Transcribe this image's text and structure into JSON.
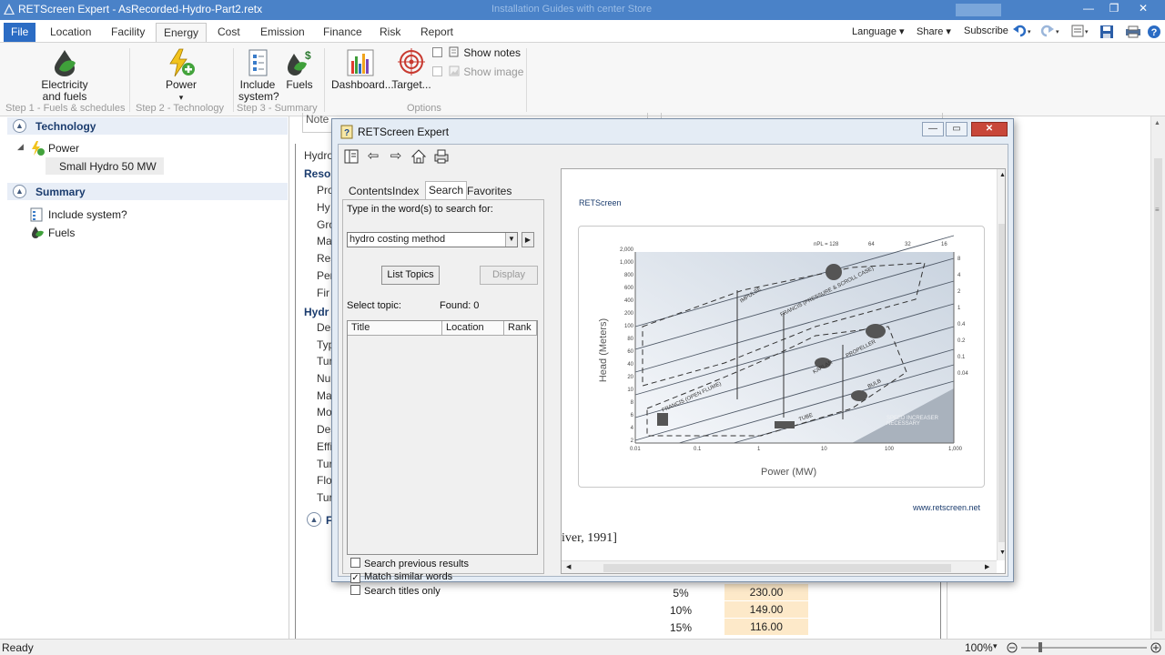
{
  "window": {
    "title": "RETScreen Expert - AsRecorded-Hydro-Part2.retx",
    "background_title": "Installation Guides with center Store"
  },
  "ribbon_tabs": [
    "File",
    "Location",
    "Facility",
    "Energy",
    "Cost",
    "Emission",
    "Finance",
    "Risk",
    "Report"
  ],
  "active_tab": "Energy",
  "right_menu": {
    "language": "Language ▾",
    "share": "Share ▾",
    "subscribe": "Subscribe"
  },
  "ribbon": {
    "electricity": "Electricity\nand fuels",
    "electricity_l1": "Electricity",
    "electricity_l2": "and fuels",
    "power": "Power",
    "power_arrow": "▾",
    "include_l1": "Include",
    "include_l2": "system?",
    "fuels": "Fuels",
    "dashboard": "Dashboard...",
    "target": "Target...",
    "show_notes": "Show notes",
    "show_image": "Show image",
    "group_step1": "Step 1 - Fuels & schedules",
    "group_step2": "Step 2 - Technology",
    "group_step3": "Step 3 - Summary",
    "group_options": "Options",
    "icons": {
      "electricity": "drop-leaf-icon",
      "power": "bolt-plus-icon",
      "include": "checklist-icon",
      "fuels": "fuels-icon",
      "dashboard": "bar-chart-icon",
      "target": "target-icon"
    }
  },
  "left_tree": {
    "technology_header": "Technology",
    "power": "Power",
    "power_child": "Small Hydro 50 MW",
    "summary_header": "Summary",
    "include_system": "Include system?",
    "fuels": "Fuels"
  },
  "background": {
    "note": "Note",
    "hydro": "Hydro",
    "resource": "Resou",
    "labels_a": [
      "Pro",
      "Hy",
      "Gro",
      "Ma",
      "Res",
      "Per",
      "Fir"
    ],
    "hydro_bold": "Hydr",
    "labels_b": [
      "Des",
      "Typ",
      "Tur",
      "Nu",
      "Ma",
      "Mo",
      "Des",
      "Effi",
      "Tur",
      "Flo",
      "Tur"
    ],
    "f_section": "F",
    "rows": [
      {
        "pct": "5%",
        "value": "230.00"
      },
      {
        "pct": "10%",
        "value": "149.00"
      },
      {
        "pct": "15%",
        "value": "116.00"
      }
    ]
  },
  "help": {
    "title": "RETScreen Expert",
    "tabs": [
      "Contents",
      "Index",
      "Search",
      "Favorites"
    ],
    "active_tab": "Search",
    "prompt": "Type in the word(s) to search for:",
    "search_value": "hydro costing method",
    "list_topics": "List Topics",
    "display": "Display",
    "select_topic": "Select topic:",
    "found": "Found: 0",
    "columns": [
      "Title",
      "Location",
      "Rank"
    ],
    "options": [
      {
        "label": "Search previous results",
        "checked": false
      },
      {
        "label": "Match similar words",
        "checked": true
      },
      {
        "label": "Search titles only",
        "checked": false
      }
    ],
    "content": {
      "brand": "RETScreen",
      "website": "www.retscreen.net",
      "citation": "iver, 1991]",
      "figure_ylabel": "Head (Meters)",
      "figure_xlabel": "Power (MW)",
      "y_ticks": [
        "2,000",
        "1,000",
        "800",
        "600",
        "400",
        "200",
        "100",
        "80",
        "60",
        "40",
        "20",
        "10",
        "8",
        "6",
        "4",
        "2"
      ],
      "x_ticks": [
        "0.01",
        "0.1",
        "1",
        "10",
        "100",
        "1,000"
      ],
      "right_ticks": [
        "8",
        "4",
        "2",
        "1",
        "0.4",
        "0.2",
        "0.1",
        "0.04"
      ],
      "top_ticks": [
        "nPL = 128",
        "64",
        "32",
        "16"
      ],
      "regions": [
        "IMPULSE",
        "FRANCIS (PRESSURE & SCROLL CASE)",
        "KAPLAN",
        "PROPELLER",
        "BULB",
        "TUBE",
        "FRANCIS (OPEN FLUME)",
        "SPEED INCREASER NECESSARY"
      ]
    }
  },
  "status": {
    "ready": "Ready",
    "zoom": "100%"
  }
}
